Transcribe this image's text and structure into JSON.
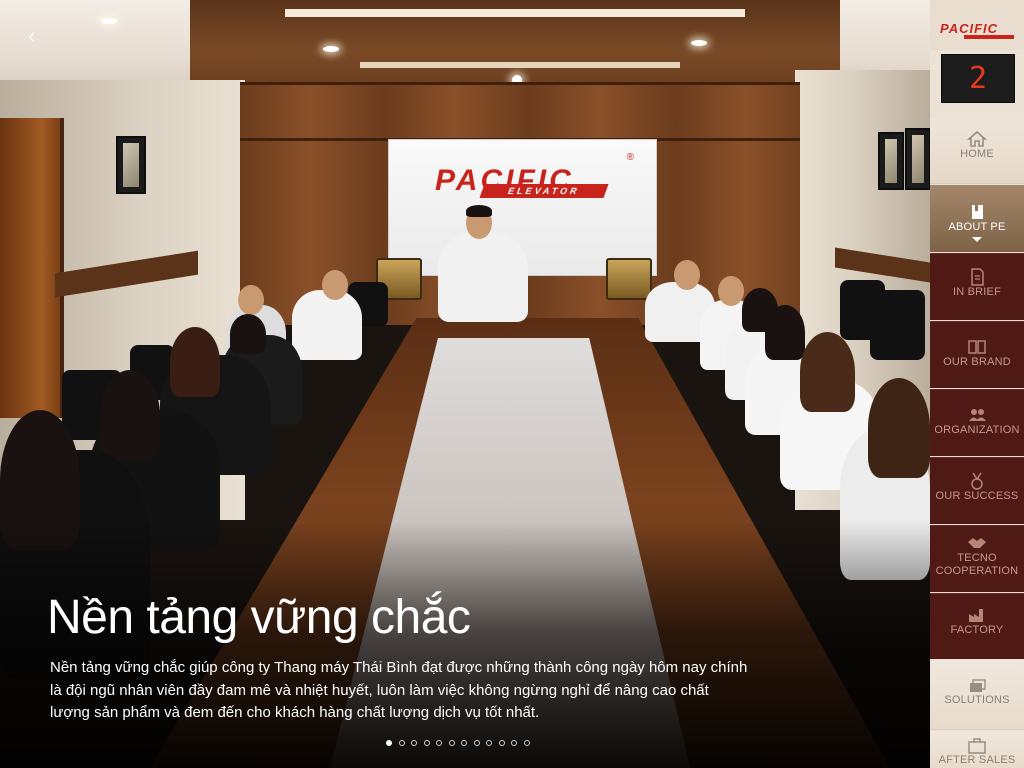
{
  "slide": {
    "title": "Nền tảng vững chắc",
    "body": "Nền tảng vững chắc giúp công ty Thang máy Thái Bình đạt được những thành công ngày hôm nay chính là đội ngũ nhân viên đầy đam mê và nhiệt huyết, luôn làm việc không ngừng nghỉ để nâng cao chất lượng sản phẩm và đem đến cho khách hàng chất lượng dịch vụ tốt nhất.",
    "prev_symbol": "‹",
    "photo_logo": "PACIFIC",
    "photo_logo_sub": "ELEVATOR",
    "photo_logo_reg": "®",
    "dot_count": 12,
    "active_dot_index": 0
  },
  "sidebar": {
    "brand": "PACIFIC",
    "floor_indicator": "2",
    "items": [
      {
        "label": "HOME",
        "icon": "home-icon"
      },
      {
        "label": "ABOUT PE",
        "icon": "book-icon",
        "active": true
      },
      {
        "label": "IN BRIEF",
        "icon": "document-icon"
      },
      {
        "label": "OUR BRAND",
        "icon": "open-book-icon"
      },
      {
        "label": "ORGANIZATION",
        "icon": "people-icon"
      },
      {
        "label": "OUR SUCCESS",
        "icon": "medal-icon"
      },
      {
        "label": "TECNO COOPERATION",
        "icon": "handshake-icon"
      },
      {
        "label": "FACTORY",
        "icon": "factory-icon"
      },
      {
        "label": "SOLUTIONS",
        "icon": "layers-icon"
      },
      {
        "label": "AFTER SALES",
        "icon": "toolbox-icon"
      }
    ]
  },
  "colors": {
    "accent_red": "#c8241c",
    "submenu_bg": "#4f1915",
    "active_bg": "#8f7357",
    "sidebar_bg": "#ece2d5"
  }
}
